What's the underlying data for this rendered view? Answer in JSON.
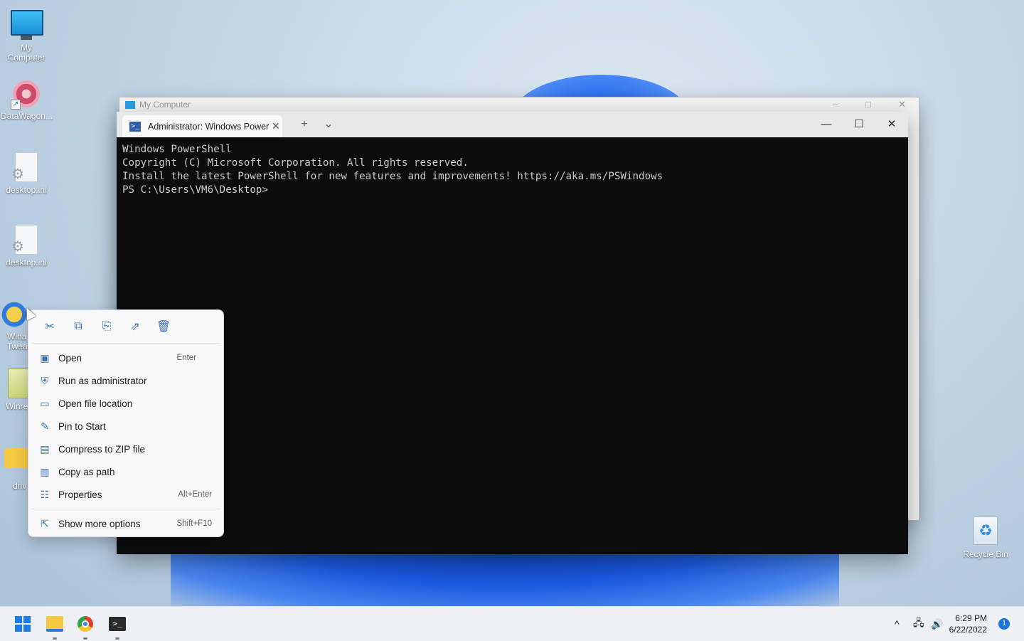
{
  "desktop": {
    "icons": [
      {
        "label": "My Computer",
        "icon": "monitor-icon"
      },
      {
        "label": "DataWagon...",
        "icon": "app-icon"
      },
      {
        "label": "desktop.ini",
        "icon": "settings-file-icon"
      },
      {
        "label": "desktop.ini",
        "icon": "settings-file-icon"
      },
      {
        "label": "Wina Twea",
        "icon": "app-shortcut-icon"
      },
      {
        "label": "Winre",
        "icon": "archive-icon"
      },
      {
        "label": "driv",
        "icon": "folder-icon"
      },
      {
        "label": "Recycle Bin",
        "icon": "recycle-bin-icon"
      }
    ]
  },
  "background_window": {
    "title": "My Computer",
    "controls": {
      "minimize": "–",
      "maximize": "□",
      "close": "✕"
    }
  },
  "terminal": {
    "tab_title": "Administrator: Windows PowerS",
    "tab_close": "✕",
    "new_tab": "+",
    "dropdown": "⌄",
    "controls": {
      "minimize": "—",
      "maximize": "☐",
      "close": "✕"
    },
    "lines": [
      "Windows PowerShell",
      "Copyright (C) Microsoft Corporation. All rights reserved.",
      "",
      "Install the latest PowerShell for new features and improvements! https://aka.ms/PSWindows",
      "",
      "PS C:\\Users\\VM6\\Desktop>"
    ]
  },
  "context_menu": {
    "quick_actions": [
      {
        "name": "cut",
        "glyph": "✂"
      },
      {
        "name": "copy",
        "glyph": "⧉"
      },
      {
        "name": "rename",
        "glyph": "⎘"
      },
      {
        "name": "share",
        "glyph": "⇗"
      },
      {
        "name": "delete",
        "glyph": "🗑"
      }
    ],
    "items": [
      {
        "label": "Open",
        "shortcut": "Enter",
        "glyph": "▣"
      },
      {
        "label": "Run as administrator",
        "shortcut": "",
        "glyph": "⛨"
      },
      {
        "label": "Open file location",
        "shortcut": "",
        "glyph": "▭"
      },
      {
        "label": "Pin to Start",
        "shortcut": "",
        "glyph": "✎"
      },
      {
        "label": "Compress to ZIP file",
        "shortcut": "",
        "glyph": "▤"
      },
      {
        "label": "Copy as path",
        "shortcut": "",
        "glyph": "▥"
      },
      {
        "label": "Properties",
        "shortcut": "Alt+Enter",
        "glyph": "☷"
      }
    ],
    "more": {
      "label": "Show more options",
      "shortcut": "Shift+F10",
      "glyph": "⇱"
    }
  },
  "taskbar": {
    "apps": [
      "start-button",
      "file-explorer",
      "chrome",
      "terminal"
    ],
    "tray": {
      "chevron": "^",
      "network": "🖧",
      "volume": "🔊"
    },
    "time": "6:29 PM",
    "date": "6/22/2022",
    "notifications": "1"
  },
  "colors": {
    "terminal_bg": "#0c0c0c",
    "terminal_text": "#cccccc",
    "accent": "#1e7ce8"
  }
}
